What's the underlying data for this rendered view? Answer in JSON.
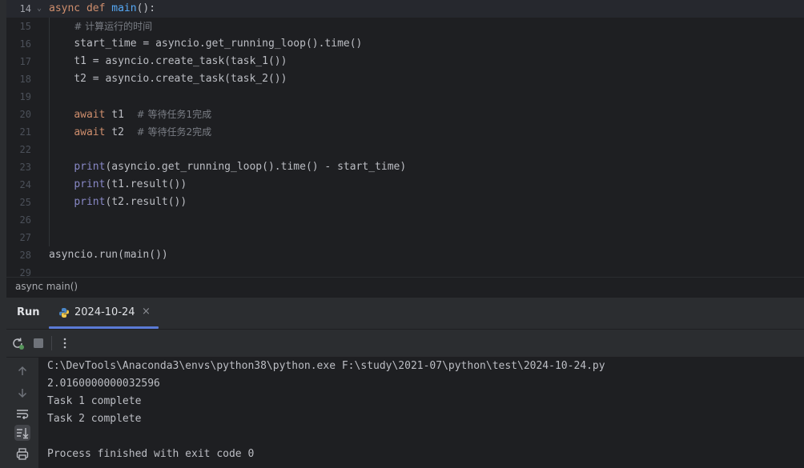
{
  "editor": {
    "lines": [
      {
        "n": "14",
        "code": "async def main():"
      },
      {
        "n": "15",
        "code": "    # 计算运行的时间"
      },
      {
        "n": "16",
        "code": "    start_time = asyncio.get_running_loop().time()"
      },
      {
        "n": "17",
        "code": "    t1 = asyncio.create_task(task_1())"
      },
      {
        "n": "18",
        "code": "    t2 = asyncio.create_task(task_2())"
      },
      {
        "n": "19",
        "code": ""
      },
      {
        "n": "20",
        "code": "    await t1  # 等待任务1完成"
      },
      {
        "n": "21",
        "code": "    await t2  # 等待任务2完成"
      },
      {
        "n": "22",
        "code": ""
      },
      {
        "n": "23",
        "code": "    print(asyncio.get_running_loop().time() - start_time)"
      },
      {
        "n": "24",
        "code": "    print(t1.result())"
      },
      {
        "n": "25",
        "code": "    print(t2.result())"
      },
      {
        "n": "26",
        "code": ""
      },
      {
        "n": "27",
        "code": ""
      },
      {
        "n": "28",
        "code": "asyncio.run(main())"
      },
      {
        "n": "29",
        "code": ""
      }
    ]
  },
  "breadcrumb": "async main()",
  "run": {
    "title": "Run",
    "tab_label": "2024-10-24",
    "tab_close": "×"
  },
  "console": {
    "lines": [
      "C:\\DevTools\\Anaconda3\\envs\\python38\\python.exe F:\\study\\2021-07\\python\\test\\2024-10-24.py",
      "2.0160000000032596",
      "Task 1 complete",
      "Task 2 complete",
      "",
      "Process finished with exit code 0"
    ]
  },
  "icons": {
    "rerun": "rerun-icon",
    "stop": "stop-icon",
    "more": "more-vertical-icon",
    "up": "arrow-up-icon",
    "down": "arrow-down-icon",
    "wrap": "soft-wrap-icon",
    "scroll_end": "scroll-to-end-icon",
    "print": "print-icon"
  },
  "colors": {
    "keyword": "#cf8e6d",
    "function": "#56a8f5",
    "comment": "#7a7e85",
    "builtin": "#8888c6",
    "tab_underline": "#5b7bd6"
  }
}
